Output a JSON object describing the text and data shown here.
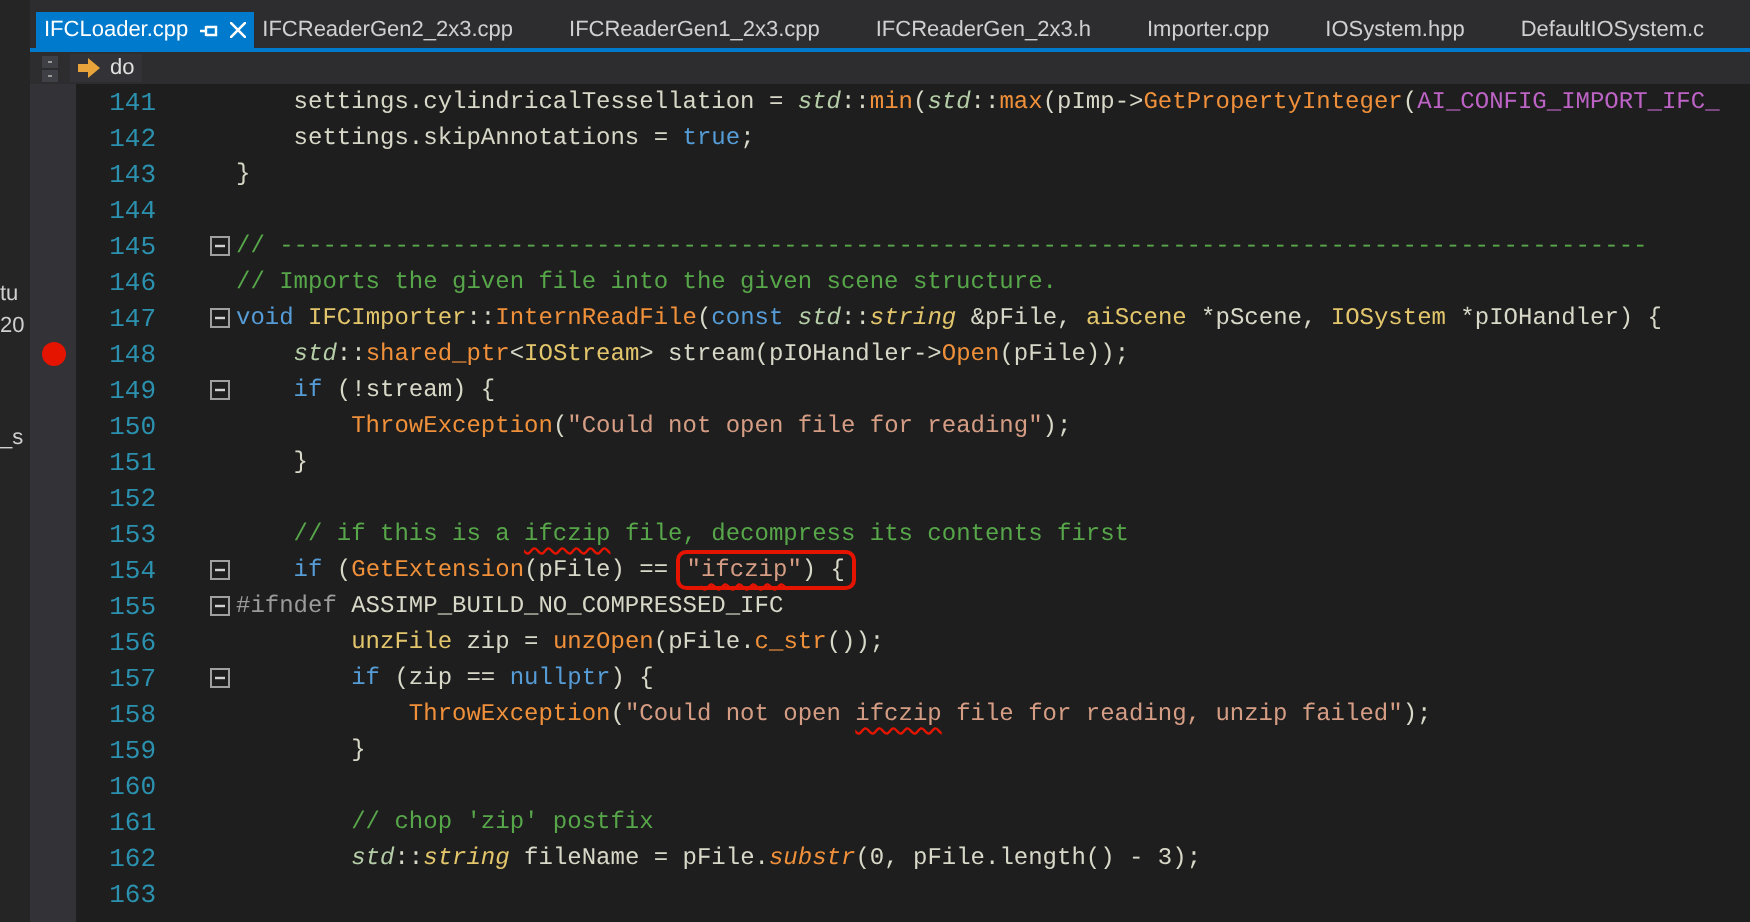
{
  "side_panel": {
    "fragments": [
      "tu",
      "20",
      "_s"
    ]
  },
  "tabs": [
    {
      "label": "IFCLoader.cpp",
      "selected": true,
      "pinned": true
    },
    {
      "label": "IFCReaderGen2_2x3.cpp",
      "selected": false,
      "pinned": false
    },
    {
      "label": "IFCReaderGen1_2x3.cpp",
      "selected": false,
      "pinned": false
    },
    {
      "label": "IFCReaderGen_2x3.h",
      "selected": false,
      "pinned": false
    },
    {
      "label": "Importer.cpp",
      "selected": false,
      "pinned": false
    },
    {
      "label": "IOSystem.hpp",
      "selected": false,
      "pinned": false
    },
    {
      "label": "DefaultIOSystem.c",
      "selected": false,
      "pinned": false
    }
  ],
  "navigation_bar": {
    "scope": "do"
  },
  "editor": {
    "lines": [
      {
        "number": "141",
        "breakpoint": false,
        "fold_marker": false,
        "tokens": [
          {
            "kind": "plain",
            "text": "    settings.cylindricalTessellation = "
          },
          {
            "kind": "ns",
            "text": "std"
          },
          {
            "kind": "plain",
            "text": "::"
          },
          {
            "kind": "func",
            "text": "min"
          },
          {
            "kind": "plain",
            "text": "("
          },
          {
            "kind": "ns",
            "text": "std"
          },
          {
            "kind": "plain",
            "text": "::"
          },
          {
            "kind": "func",
            "text": "max"
          },
          {
            "kind": "plain",
            "text": "(pImp->"
          },
          {
            "kind": "func",
            "text": "GetPropertyInteger"
          },
          {
            "kind": "plain",
            "text": "("
          },
          {
            "kind": "macro",
            "text": "AI_CONFIG_IMPORT_IFC_"
          }
        ]
      },
      {
        "number": "142",
        "breakpoint": false,
        "fold_marker": false,
        "tokens": [
          {
            "kind": "plain",
            "text": "    settings.skipAnnotations = "
          },
          {
            "kind": "keyword",
            "text": "true"
          },
          {
            "kind": "plain",
            "text": ";"
          }
        ]
      },
      {
        "number": "143",
        "breakpoint": false,
        "fold_marker": false,
        "tokens": [
          {
            "kind": "plain",
            "text": "}"
          }
        ]
      },
      {
        "number": "144",
        "breakpoint": false,
        "fold_marker": false
      },
      {
        "number": "145",
        "breakpoint": false,
        "fold_marker": true,
        "tokens": [
          {
            "kind": "comment",
            "text": "// -----------------------------------------------------------------------------------------------"
          }
        ]
      },
      {
        "number": "146",
        "breakpoint": false,
        "fold_marker": false,
        "tokens": [
          {
            "kind": "comment",
            "text": "// Imports the given file into the given scene structure."
          }
        ]
      },
      {
        "number": "147",
        "breakpoint": false,
        "fold_marker": true,
        "tokens": [
          {
            "kind": "keyword",
            "text": "void "
          },
          {
            "kind": "class",
            "text": "IFCImporter"
          },
          {
            "kind": "plain",
            "text": "::"
          },
          {
            "kind": "func",
            "text": "InternReadFile"
          },
          {
            "kind": "plain",
            "text": "("
          },
          {
            "kind": "keyword",
            "text": "const "
          },
          {
            "kind": "ns",
            "text": "std"
          },
          {
            "kind": "plain",
            "text": "::"
          },
          {
            "kind": "class_italic",
            "text": "string"
          },
          {
            "kind": "plain",
            "text": " &pFile, "
          },
          {
            "kind": "class",
            "text": "aiScene"
          },
          {
            "kind": "plain",
            "text": " *pScene, "
          },
          {
            "kind": "class",
            "text": "IOSystem"
          },
          {
            "kind": "plain",
            "text": " *pIOHandler) {"
          }
        ]
      },
      {
        "number": "148",
        "breakpoint": true,
        "fold_marker": false,
        "tokens": [
          {
            "kind": "ns",
            "text": "    std"
          },
          {
            "kind": "plain",
            "text": "::"
          },
          {
            "kind": "func",
            "text": "shared_ptr"
          },
          {
            "kind": "plain",
            "text": "<"
          },
          {
            "kind": "class",
            "text": "IOStream"
          },
          {
            "kind": "plain",
            "text": "> stream(pIOHandler->"
          },
          {
            "kind": "func",
            "text": "Open"
          },
          {
            "kind": "plain",
            "text": "(pFile));"
          }
        ]
      },
      {
        "number": "149",
        "breakpoint": false,
        "fold_marker": true,
        "tokens": [
          {
            "kind": "keyword",
            "text": "    if"
          },
          {
            "kind": "plain",
            "text": " (!stream) {"
          }
        ]
      },
      {
        "number": "150",
        "breakpoint": false,
        "fold_marker": false,
        "tokens": [
          {
            "kind": "func",
            "text": "        ThrowException"
          },
          {
            "kind": "plain",
            "text": "("
          },
          {
            "kind": "string",
            "text": "\"Could not open file for reading\""
          },
          {
            "kind": "plain",
            "text": ");"
          }
        ]
      },
      {
        "number": "151",
        "breakpoint": false,
        "fold_marker": false,
        "tokens": [
          {
            "kind": "plain",
            "text": "    }"
          }
        ]
      },
      {
        "number": "152",
        "breakpoint": false,
        "fold_marker": false
      },
      {
        "number": "153",
        "breakpoint": false,
        "fold_marker": false,
        "tokens": [
          {
            "kind": "comment",
            "text": "    // if this is a "
          },
          {
            "kind": "comment",
            "text": "ifczip",
            "squiggle": true
          },
          {
            "kind": "comment",
            "text": " file, decompress its contents first"
          }
        ]
      },
      {
        "number": "154",
        "breakpoint": false,
        "fold_marker": true,
        "tokens": [
          {
            "kind": "keyword",
            "text": "    if"
          },
          {
            "kind": "plain",
            "text": " ("
          },
          {
            "kind": "func",
            "text": "GetExtension"
          },
          {
            "kind": "plain",
            "text": "(pFile) == "
          },
          {
            "kind": "box",
            "tokens": [
              {
                "kind": "string",
                "text": "\""
              },
              {
                "kind": "string",
                "text": "ifczip",
                "squiggle": true
              },
              {
                "kind": "string",
                "text": "\""
              },
              {
                "kind": "plain",
                "text": ") {"
              }
            ]
          }
        ]
      },
      {
        "number": "155",
        "breakpoint": false,
        "fold_marker": true,
        "tokens": [
          {
            "kind": "preproc",
            "text": "#ifndef "
          },
          {
            "kind": "plain",
            "text": "ASSIMP_BUILD_NO_COMPRESSED_IFC"
          }
        ]
      },
      {
        "number": "156",
        "breakpoint": false,
        "fold_marker": false,
        "tokens": [
          {
            "kind": "class",
            "text": "        unzFile"
          },
          {
            "kind": "plain",
            "text": " zip = "
          },
          {
            "kind": "func",
            "text": "unzOpen"
          },
          {
            "kind": "plain",
            "text": "(pFile."
          },
          {
            "kind": "func",
            "text": "c_str"
          },
          {
            "kind": "plain",
            "text": "());"
          }
        ]
      },
      {
        "number": "157",
        "breakpoint": false,
        "fold_marker": true,
        "tokens": [
          {
            "kind": "keyword",
            "text": "        if"
          },
          {
            "kind": "plain",
            "text": " (zip == "
          },
          {
            "kind": "keyword",
            "text": "nullptr"
          },
          {
            "kind": "plain",
            "text": ") {"
          }
        ]
      },
      {
        "number": "158",
        "breakpoint": false,
        "fold_marker": false,
        "tokens": [
          {
            "kind": "func",
            "text": "            ThrowException"
          },
          {
            "kind": "plain",
            "text": "("
          },
          {
            "kind": "string",
            "text": "\"Could not open "
          },
          {
            "kind": "string",
            "text": "ifczip",
            "squiggle": true
          },
          {
            "kind": "string",
            "text": " file for reading, unzip failed\""
          },
          {
            "kind": "plain",
            "text": ");"
          }
        ]
      },
      {
        "number": "159",
        "breakpoint": false,
        "fold_marker": false,
        "tokens": [
          {
            "kind": "plain",
            "text": "        }"
          }
        ]
      },
      {
        "number": "160",
        "breakpoint": false,
        "fold_marker": false
      },
      {
        "number": "161",
        "breakpoint": false,
        "fold_marker": false,
        "tokens": [
          {
            "kind": "comment",
            "text": "        // chop 'zip' postfix"
          }
        ]
      },
      {
        "number": "162",
        "breakpoint": false,
        "fold_marker": false,
        "tokens": [
          {
            "kind": "ns",
            "text": "        std"
          },
          {
            "kind": "plain",
            "text": "::"
          },
          {
            "kind": "class_italic",
            "text": "string"
          },
          {
            "kind": "plain",
            "text": " fileName = pFile."
          },
          {
            "kind": "func_italic",
            "text": "substr"
          },
          {
            "kind": "plain",
            "text": "(0, pFile.length() - 3);"
          }
        ]
      },
      {
        "number": "163",
        "breakpoint": false,
        "fold_marker": false
      }
    ]
  }
}
